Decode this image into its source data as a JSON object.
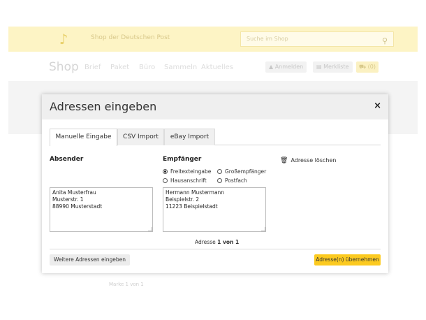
{
  "background": {
    "tagline": "Shop der Deutschen Post",
    "search_placeholder": "Suche im Shop",
    "shop_word": "Shop",
    "nav": [
      "Brief",
      "Paket",
      "Büro",
      "Sammeln",
      "Aktuelles"
    ],
    "login": "Anmelden",
    "watchlist": "Merkliste",
    "cart": "(0)",
    "page_info": "Marke 1 von 1"
  },
  "modal": {
    "title": "Adressen eingeben",
    "close": "×",
    "tabs": [
      {
        "label": "Manuelle Eingabe",
        "active": true
      },
      {
        "label": "CSV Import",
        "active": false
      },
      {
        "label": "eBay Import",
        "active": false
      }
    ],
    "sender": {
      "label": "Absender",
      "value": "Anita Musterfrau\nMusterstr. 1\n88990 Musterstadt"
    },
    "recipient": {
      "label": "Empfänger",
      "options": [
        {
          "label": "Freitexteingabe",
          "checked": true
        },
        {
          "label": "Großempfänger",
          "checked": false
        },
        {
          "label": "Hausanschrift",
          "checked": false
        },
        {
          "label": "Postfach",
          "checked": false
        }
      ],
      "value": "Hermann Mustermann\nBeispielstr. 2\n11223 Beispielstadt"
    },
    "delete_label": "Adresse löschen",
    "pager": {
      "prefix": "Adresse",
      "current": "1 von 1"
    },
    "more_button": "Weitere Adressen eingeben",
    "apply_button": "Adresse(n) übernehmen"
  },
  "colors": {
    "accent": "#fcca20",
    "header_bg": "#efefef"
  }
}
